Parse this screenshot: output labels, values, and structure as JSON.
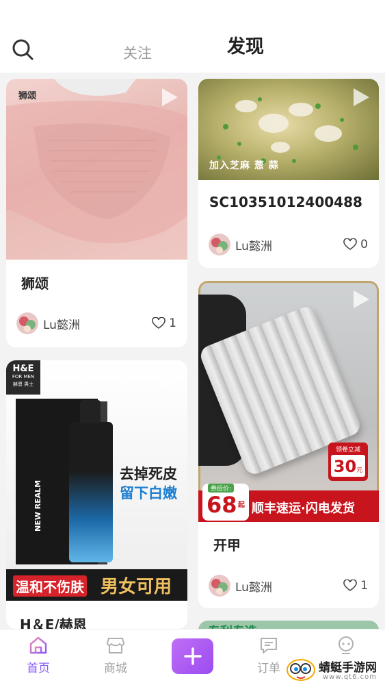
{
  "header": {
    "tab_follow": "关注",
    "tab_discover": "发现",
    "search_icon": "search-icon"
  },
  "feed": [
    {
      "watermark": "狮颂",
      "title": "狮颂",
      "author": "Lu懿洲",
      "likes": "1"
    },
    {
      "image_caption": "加入芝麻 葱 蒜",
      "title": "SC10351012400488",
      "author": "Lu懿洲",
      "likes": "0"
    },
    {
      "brand_top": "H&E",
      "brand_sub": "FOR MEN",
      "brand_badge": "赫恩 男士",
      "slogan_line1": "去掉死皮",
      "slogan_line2": "留下白嫩",
      "product_side": "NEW REALM",
      "banner_left": "温和不伤肤",
      "banner_right": "男女可用",
      "title": "H＆E/赫恩"
    },
    {
      "coupon_label": "领卷立减",
      "coupon_value": "30",
      "coupon_unit": "元",
      "price_label": "券后价:",
      "price_value": "68",
      "price_unit": "起",
      "shipping": "顺丰速运·闪电发货",
      "title": "开甲",
      "author": "Lu懿洲",
      "likes": "1"
    },
    {
      "partial_caption": "专利专选"
    }
  ],
  "bottom_nav": {
    "items": [
      {
        "label": "首页",
        "icon": "home-icon",
        "active": true
      },
      {
        "label": "商城",
        "icon": "shop-icon",
        "active": false
      },
      {
        "label": "",
        "icon": "plus-icon",
        "active": false
      },
      {
        "label": "订单",
        "icon": "message-icon",
        "active": false
      },
      {
        "label": "",
        "icon": "profile-icon",
        "active": false
      }
    ]
  },
  "watermark": {
    "name": "蜻蜓手游网",
    "url": "www.qt6.com"
  },
  "colors": {
    "accent": "#8b5cf6",
    "background": "#f3f3f3"
  }
}
